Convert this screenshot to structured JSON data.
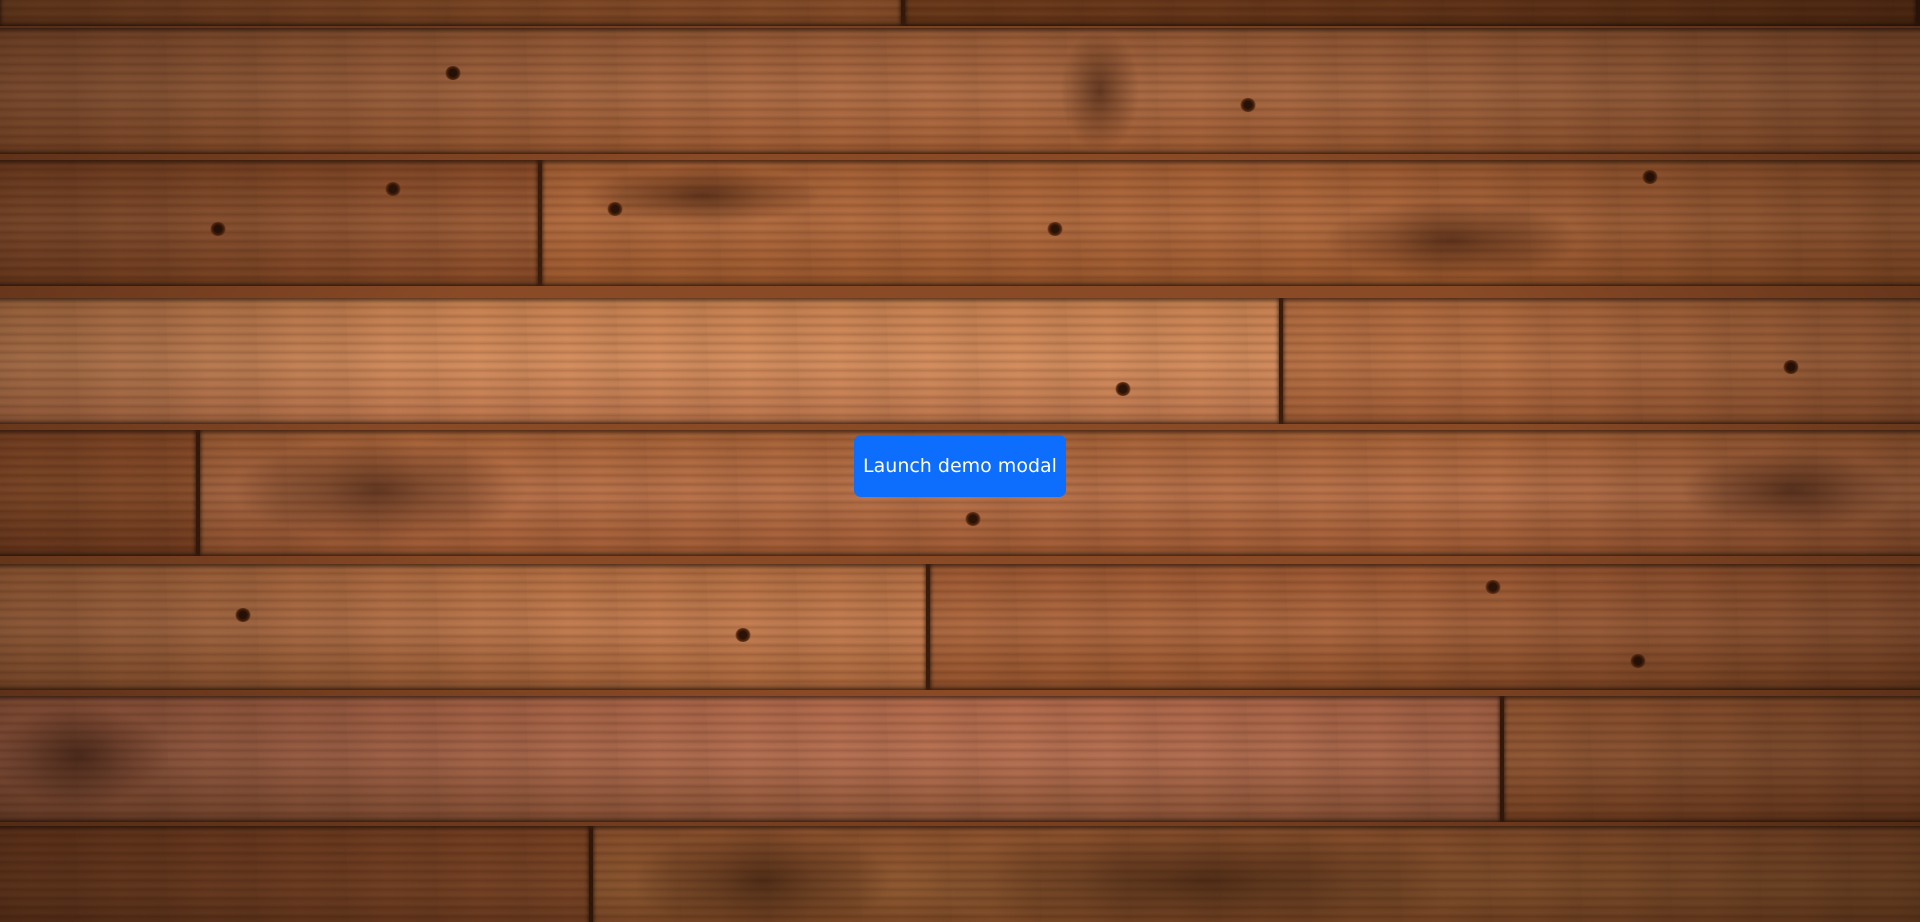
{
  "background": {
    "description_icon": "wood-floor-background",
    "colors": {
      "wood_light": "#c07a4a",
      "wood_mid": "#9a5a32",
      "wood_dark": "#6e3a1c",
      "seam": "#3a1c0c"
    }
  },
  "launch_button": {
    "label": "Launch demo modal",
    "color": "#0d6efd",
    "text_color": "#ffffff"
  }
}
